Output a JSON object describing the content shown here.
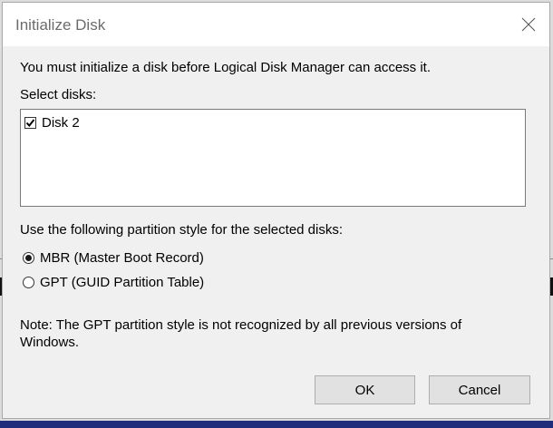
{
  "dialog": {
    "title": "Initialize Disk",
    "intro": "You must initialize a disk before Logical Disk Manager can access it.",
    "select_label": "Select disks:",
    "disks": [
      {
        "label": "Disk 2",
        "checked": true
      }
    ],
    "partition_label": "Use the following partition style for the selected disks:",
    "options": [
      {
        "label": "MBR (Master Boot Record)",
        "selected": true
      },
      {
        "label": "GPT (GUID Partition Table)",
        "selected": false
      }
    ],
    "note": "Note: The GPT partition style is not recognized by all previous versions of Windows.",
    "ok_label": "OK",
    "cancel_label": "Cancel"
  },
  "colors": {
    "title_text": "#6b6b6b",
    "dialog_bg": "#f0f0f0",
    "taskbar": "#1f2d7a"
  },
  "icons": {
    "close": "close-icon",
    "check": "checkmark-icon"
  }
}
